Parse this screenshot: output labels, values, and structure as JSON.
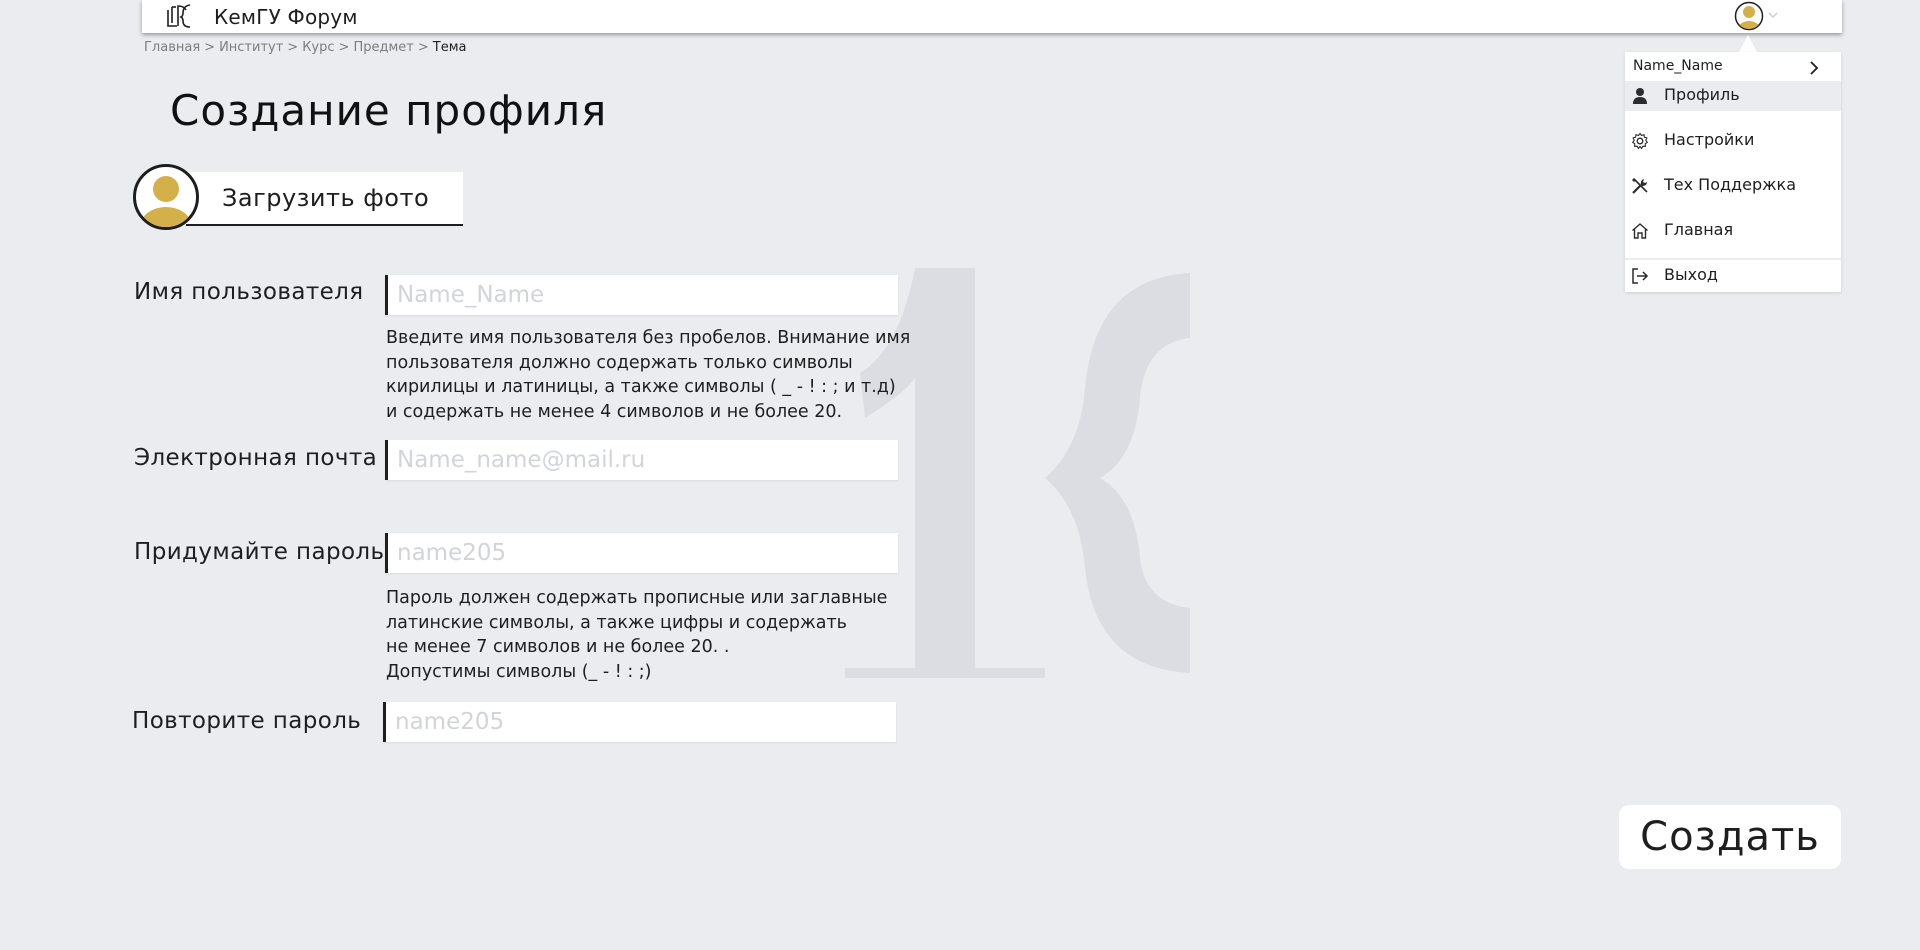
{
  "header": {
    "site_title": "КемГУ Форум"
  },
  "breadcrumb": {
    "items": [
      "Главная",
      ">",
      "Институт",
      ">",
      "Курс",
      ">",
      "Предмет",
      ">"
    ],
    "current": "Тема"
  },
  "page": {
    "title": "Создание профиля",
    "upload_photo_label": "Загрузить фото"
  },
  "form": {
    "username": {
      "label": "Имя пользователя",
      "placeholder": "Name_Name",
      "hint": "Введите имя пользователя без пробелов. Внимание имя\nпользователя должно содержать только символы\nкирилицы и латиницы, а также символы ( _  -  !  :  ; и т.д)\nи содержать не менее 4 символов и не более 20."
    },
    "email": {
      "label": "Электронная почта",
      "placeholder": "Name_name@mail.ru"
    },
    "password": {
      "label": "Придумайте пароль",
      "placeholder": "name205",
      "hint": "Пароль должен содержать прописные или заглавные\nлатинские символы, а также цифры и содержать\nне менее 7 символов и не более 20. .\nДопустимы символы (_ - ! : ;)"
    },
    "password_repeat": {
      "label": "Повторите пароль",
      "placeholder": "name205"
    },
    "submit_label": "Создать"
  },
  "user_menu": {
    "username": "Name_Name",
    "items": [
      {
        "label": "Профиль",
        "icon": "person-icon"
      },
      {
        "label": "Настройки",
        "icon": "gear-icon"
      },
      {
        "label": "Тех Поддержка",
        "icon": "tools-icon"
      },
      {
        "label": "Главная",
        "icon": "home-icon"
      },
      {
        "label": "Выход",
        "icon": "logout-icon"
      }
    ]
  },
  "colors": {
    "background": "#ebecf0",
    "avatar_accent": "#d4b04a",
    "text": "#1e1e1e",
    "placeholder": "#d2d4da"
  }
}
